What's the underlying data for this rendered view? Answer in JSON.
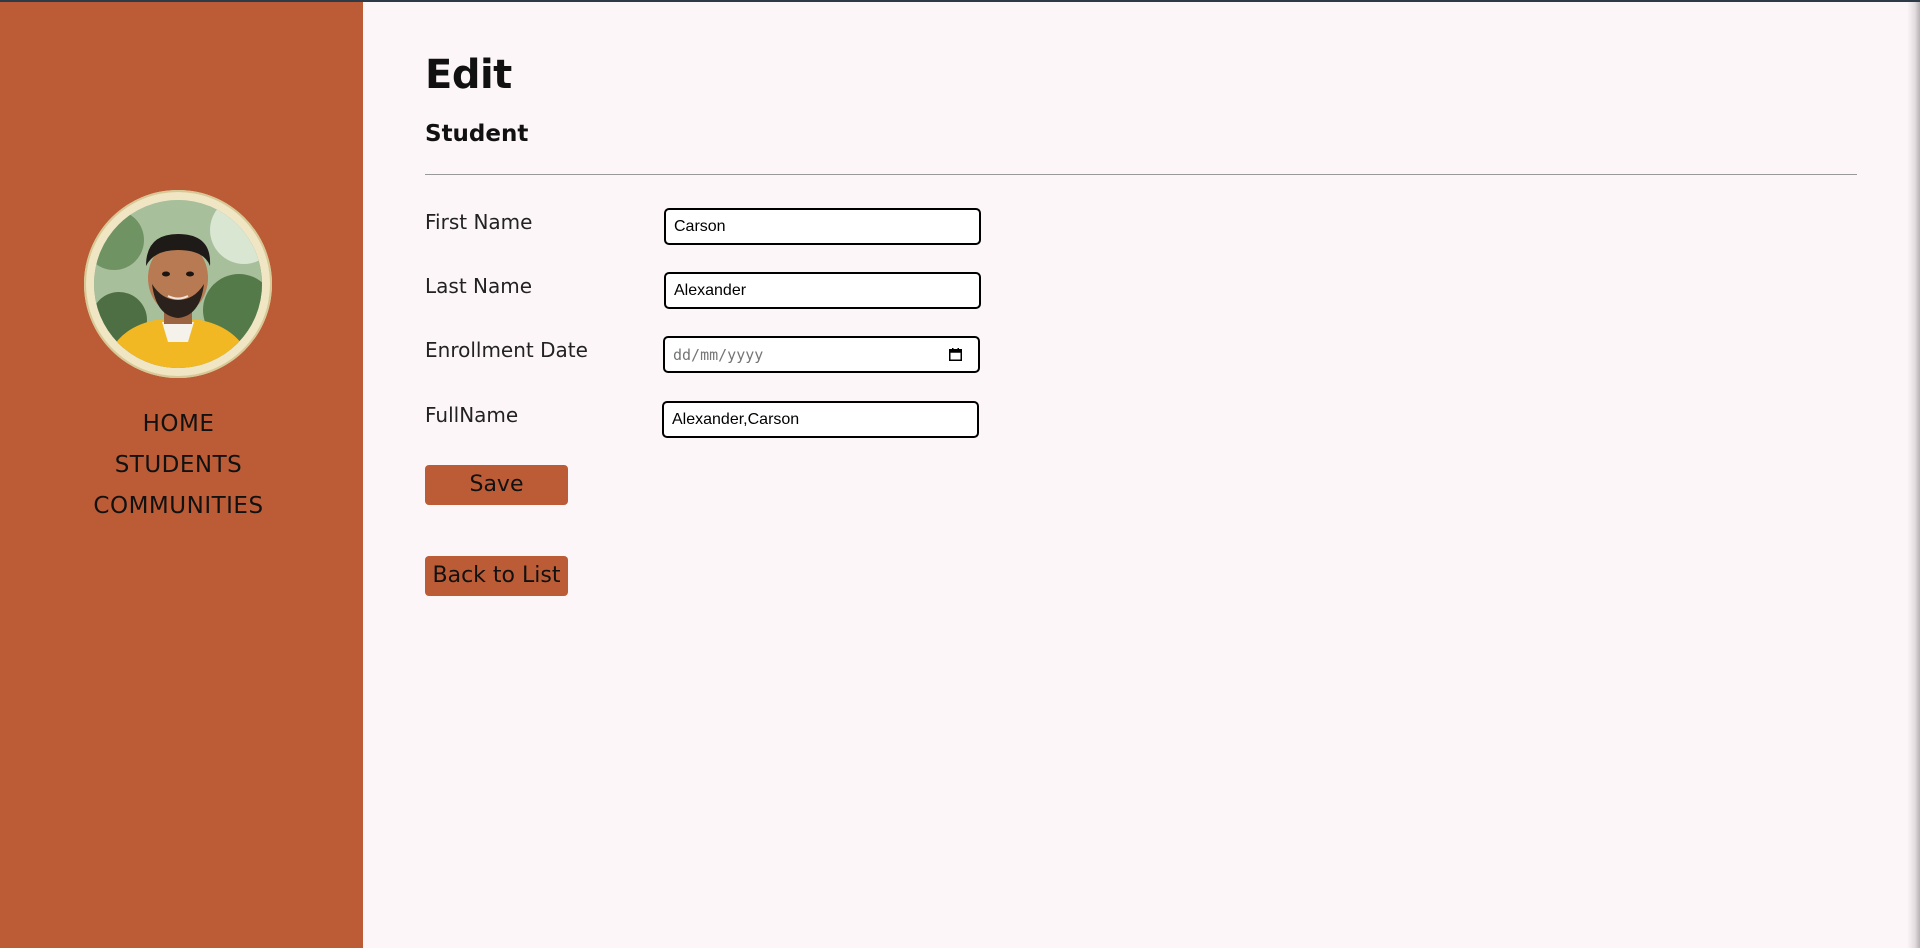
{
  "sidebar": {
    "avatar_alt": "profile photo",
    "nav": [
      {
        "label": "HOME"
      },
      {
        "label": "STUDENTS"
      },
      {
        "label": "COMMUNITIES"
      }
    ]
  },
  "page": {
    "title": "Edit",
    "subtitle": "Student"
  },
  "form": {
    "first_name": {
      "label": "First Name",
      "value": "Carson"
    },
    "last_name": {
      "label": "Last Name",
      "value": "Alexander"
    },
    "enrollment_date": {
      "label": "Enrollment Date",
      "placeholder": "dd/mm/yyyy",
      "value": ""
    },
    "full_name": {
      "label": "FullName",
      "value": "Alexander,Carson"
    },
    "save_label": "Save"
  },
  "back_label": "Back to List",
  "colors": {
    "sidebar": "#bb5c36",
    "background": "#fdf6f8",
    "button": "#bb5c36"
  },
  "icons": {
    "date": "calendar-icon"
  }
}
